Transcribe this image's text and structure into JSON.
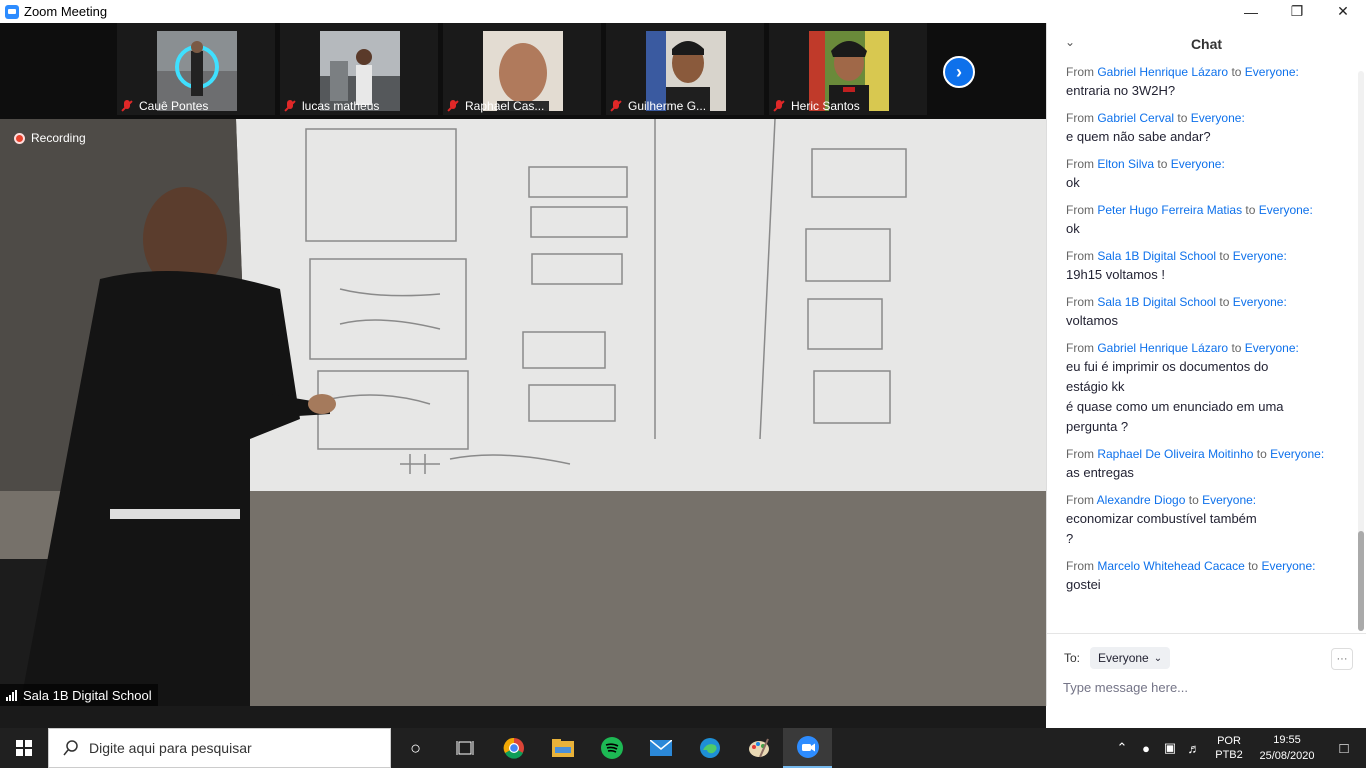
{
  "window": {
    "title": "Zoom Meeting"
  },
  "participants": [
    {
      "name": "Cauê Pontes"
    },
    {
      "name": "lucas matheus"
    },
    {
      "name": "Raphael Cas..."
    },
    {
      "name": "Guilherme G..."
    },
    {
      "name": "Heric Santos"
    }
  ],
  "video": {
    "recording_label": "Recording",
    "speaker_name": "Sala 1B Digital School"
  },
  "chat": {
    "title": "Chat",
    "from_word": "From",
    "to_word": "to",
    "messages": [
      {
        "from": "Gabriel Henrique Lázaro",
        "to": "Everyone:",
        "lines": [
          "entraria no 3W2H?"
        ]
      },
      {
        "from": "Gabriel Cerval",
        "to": "Everyone:",
        "lines": [
          "e quem não sabe andar?"
        ]
      },
      {
        "from": "Elton Silva",
        "to": "Everyone:",
        "lines": [
          "ok"
        ]
      },
      {
        "from": "Peter Hugo Ferreira Matias",
        "to": "Everyone:",
        "lines": [
          "ok"
        ]
      },
      {
        "from": "Sala 1B Digital School",
        "to": "Everyone:",
        "lines": [
          "19h15 voltamos !"
        ]
      },
      {
        "from": "Sala 1B Digital School",
        "to": "Everyone:",
        "lines": [
          "voltamos"
        ]
      },
      {
        "from": "Gabriel Henrique Lázaro",
        "to": "Everyone:",
        "lines": [
          "eu fui é imprimir os documentos do",
          "estágio kk",
          "é quase como um enunciado em uma",
          "pergunta ?"
        ]
      },
      {
        "from": "Raphael De Oliveira Moitinho",
        "to": "Everyone:",
        "lines": [
          "as entregas"
        ]
      },
      {
        "from": "Alexandre Diogo",
        "to": "Everyone:",
        "lines": [
          "economizar combustível também",
          "?"
        ]
      },
      {
        "from": "Marcelo Whitehead Cacace",
        "to": "Everyone:",
        "lines": [
          "gostei"
        ]
      }
    ],
    "to_label": "To:",
    "recipient": "Everyone",
    "input_placeholder": "Type message here...",
    "more_label": "···"
  },
  "taskbar": {
    "search_placeholder": "Digite aqui para pesquisar",
    "language_line1": "POR",
    "language_line2": "PTB2",
    "time": "19:55",
    "date": "25/08/2020"
  },
  "colors": {
    "accent": "#0e71eb",
    "muted_mic": "#e02828",
    "recording": "#e8432e"
  }
}
